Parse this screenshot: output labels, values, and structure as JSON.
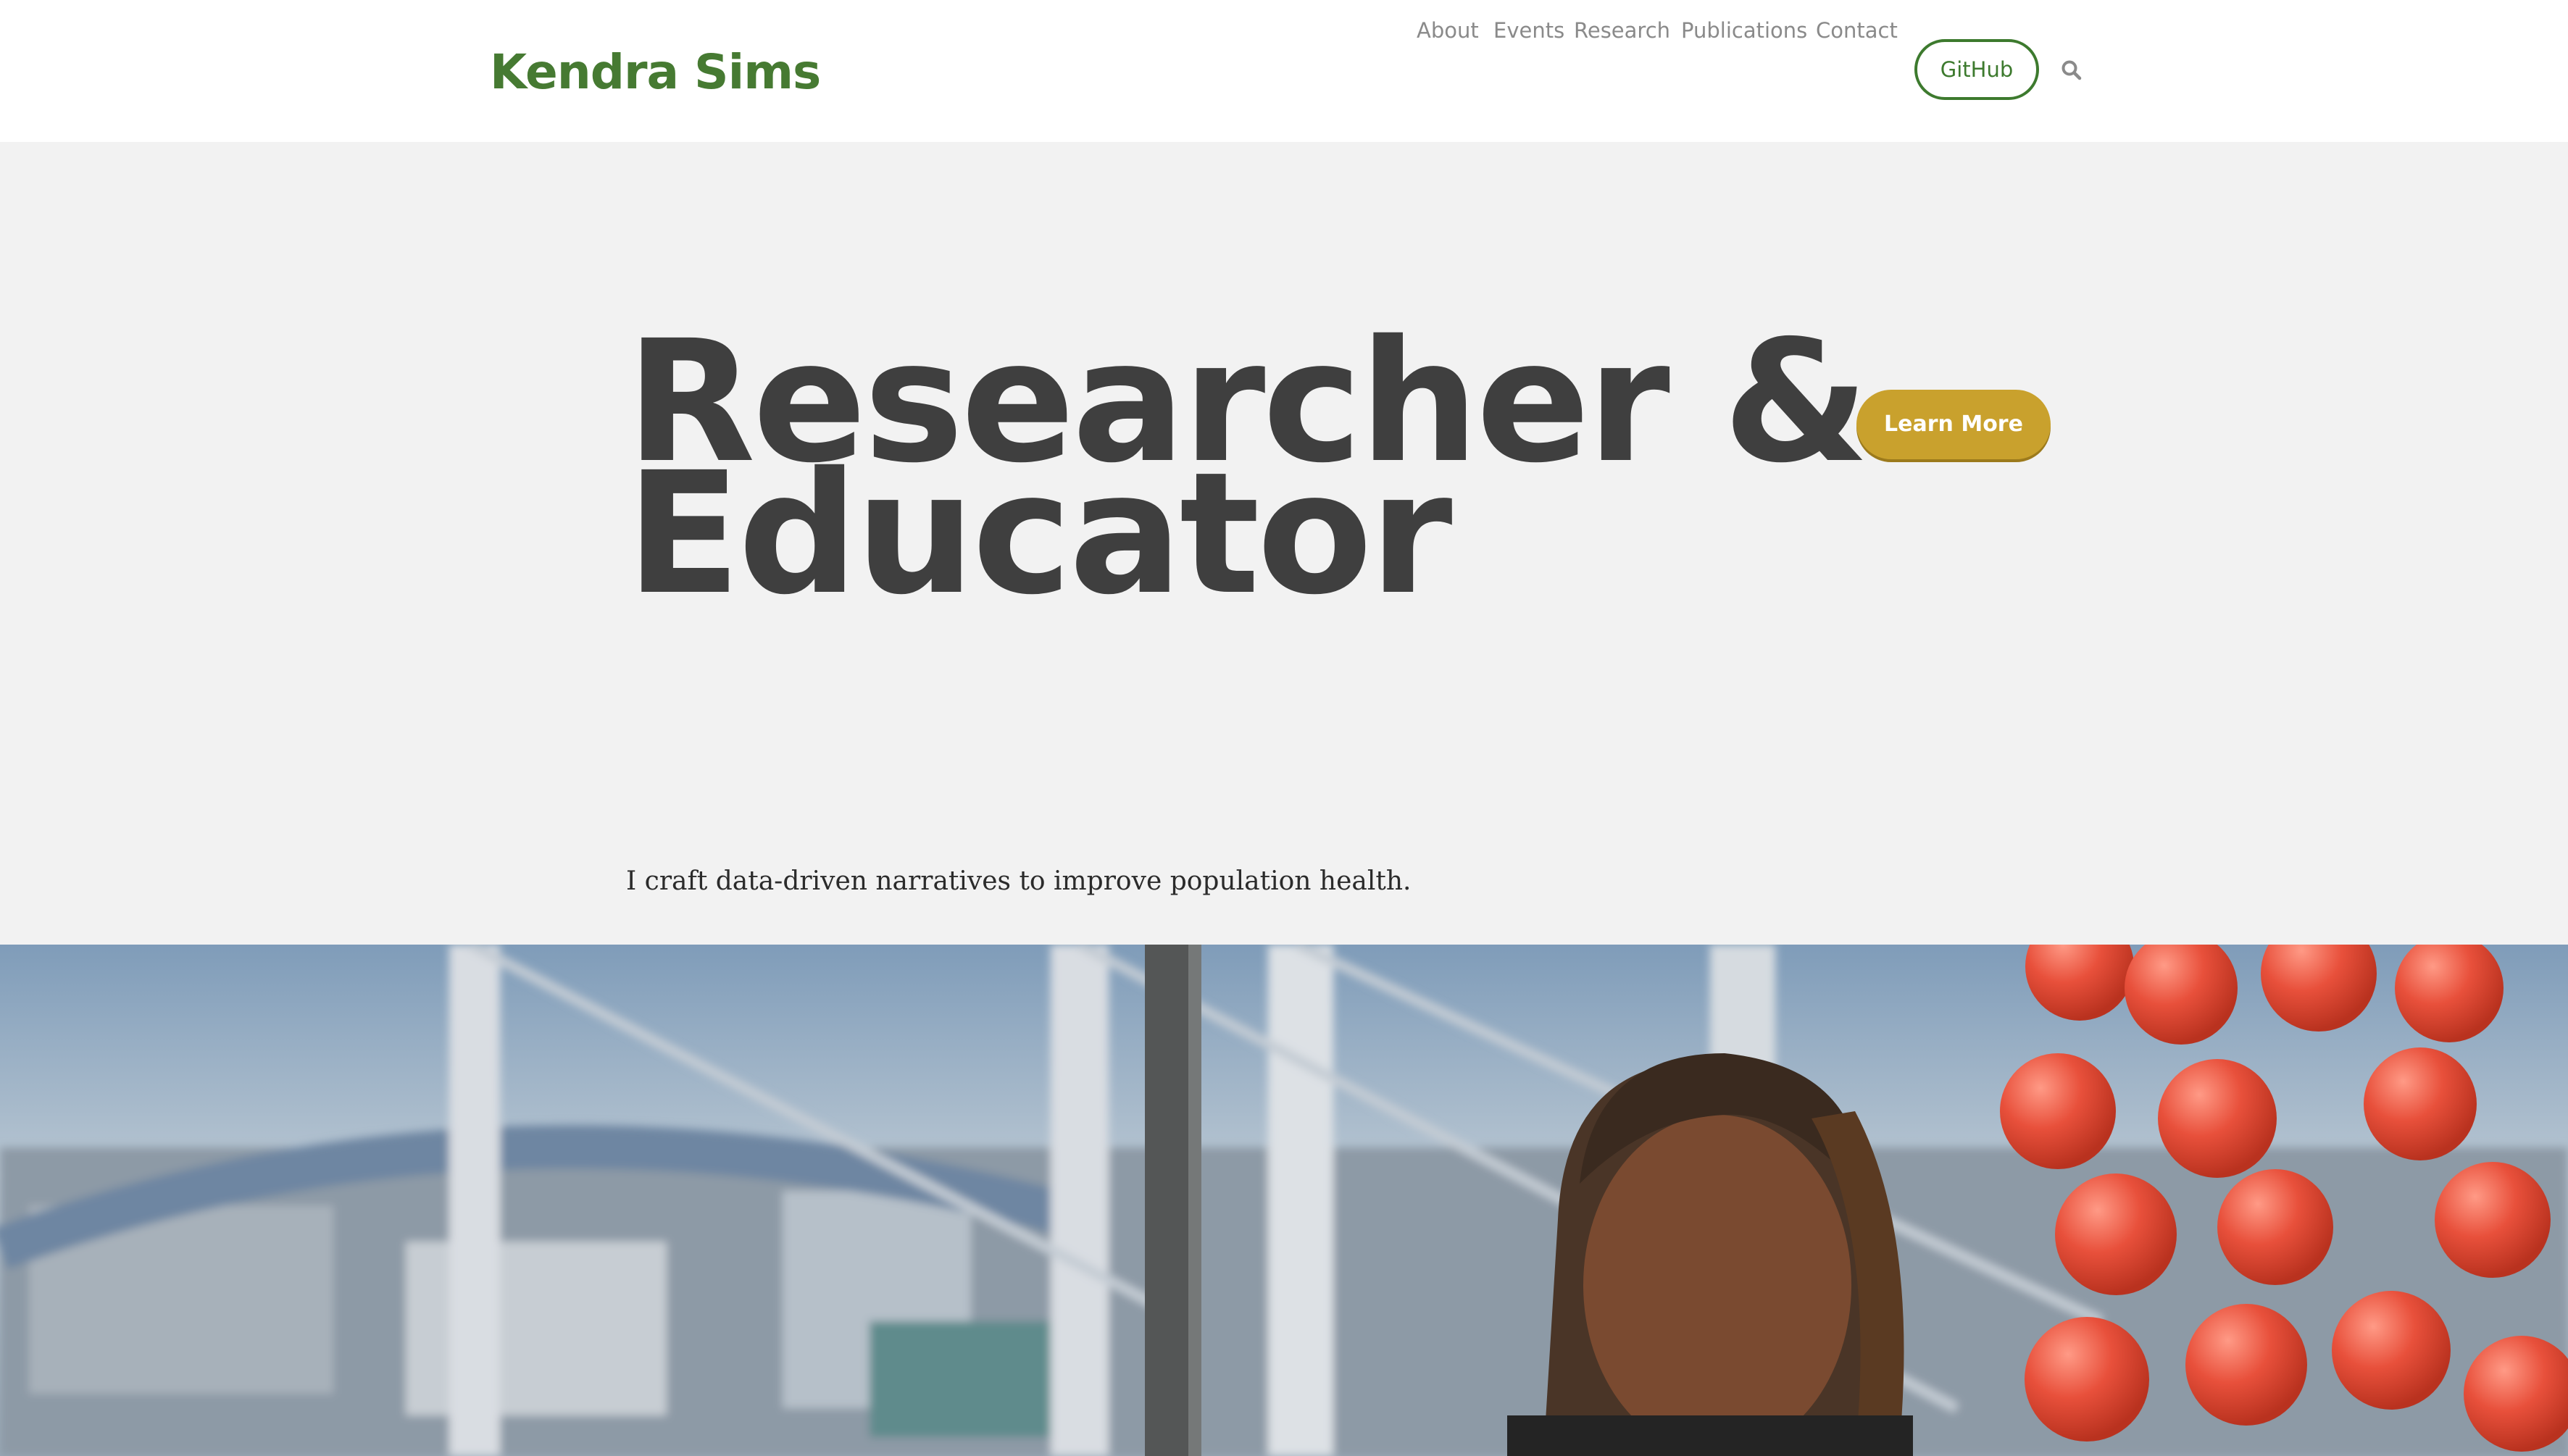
{
  "header": {
    "logo": "Kendra Sims",
    "nav": [
      "About",
      "Events",
      "Research",
      "Publications",
      "Contact"
    ],
    "github_label": "GitHub",
    "search_icon": "search-icon"
  },
  "hero": {
    "headline_line1": "Researcher &",
    "headline_line2": "Educator",
    "cta_label": "Learn More",
    "tagline": "I craft data-driven narratives to improve population health."
  },
  "colors": {
    "brand_green": "#467a32",
    "accent_gold": "#c9a12d",
    "hero_bg": "#f2f2f2",
    "headline": "#3f3f3f"
  }
}
